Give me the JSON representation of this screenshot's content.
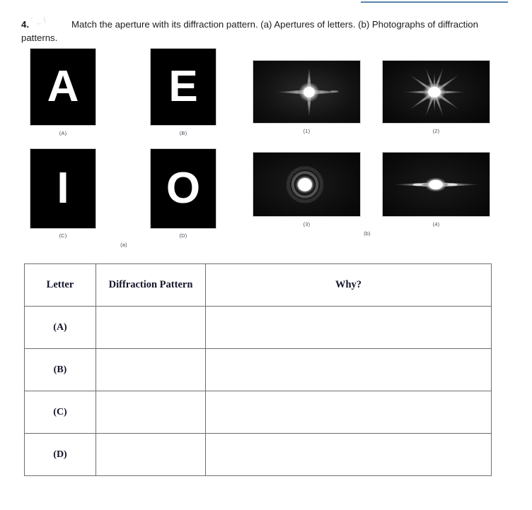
{
  "prompt": {
    "number": "4.",
    "text": "Match the aperture with its diffraction pattern. (a) Apertures of letters. (b) Photographs of diffraction patterns."
  },
  "colors": {
    "top_rule": "#5b84ad",
    "tile_background": "#000000",
    "letter_fill": "#ffffff",
    "table_border": "#6e6e6e",
    "caption_text": "#4a4a5a"
  },
  "apertures": {
    "group_label": "(a)",
    "items": [
      {
        "letter": "A",
        "caption": "(A)"
      },
      {
        "letter": "E",
        "caption": "(B)"
      },
      {
        "letter": "I",
        "caption": "(C)"
      },
      {
        "letter": "O",
        "caption": "(D)"
      }
    ]
  },
  "patterns": {
    "group_label": "(b)",
    "items": [
      {
        "caption": "(1)",
        "shape": "four-point-star"
      },
      {
        "caption": "(2)",
        "shape": "multi-ray-starburst"
      },
      {
        "caption": "(3)",
        "shape": "airy-disk-rings"
      },
      {
        "caption": "(4)",
        "shape": "horizontal-streak"
      }
    ]
  },
  "table": {
    "headers": [
      "Letter",
      "Diffraction Pattern",
      "Why?"
    ],
    "rows": [
      {
        "letter": "(A)",
        "pattern": "",
        "why": ""
      },
      {
        "letter": "(B)",
        "pattern": "",
        "why": ""
      },
      {
        "letter": "(C)",
        "pattern": "",
        "why": ""
      },
      {
        "letter": "(D)",
        "pattern": "",
        "why": ""
      }
    ]
  }
}
